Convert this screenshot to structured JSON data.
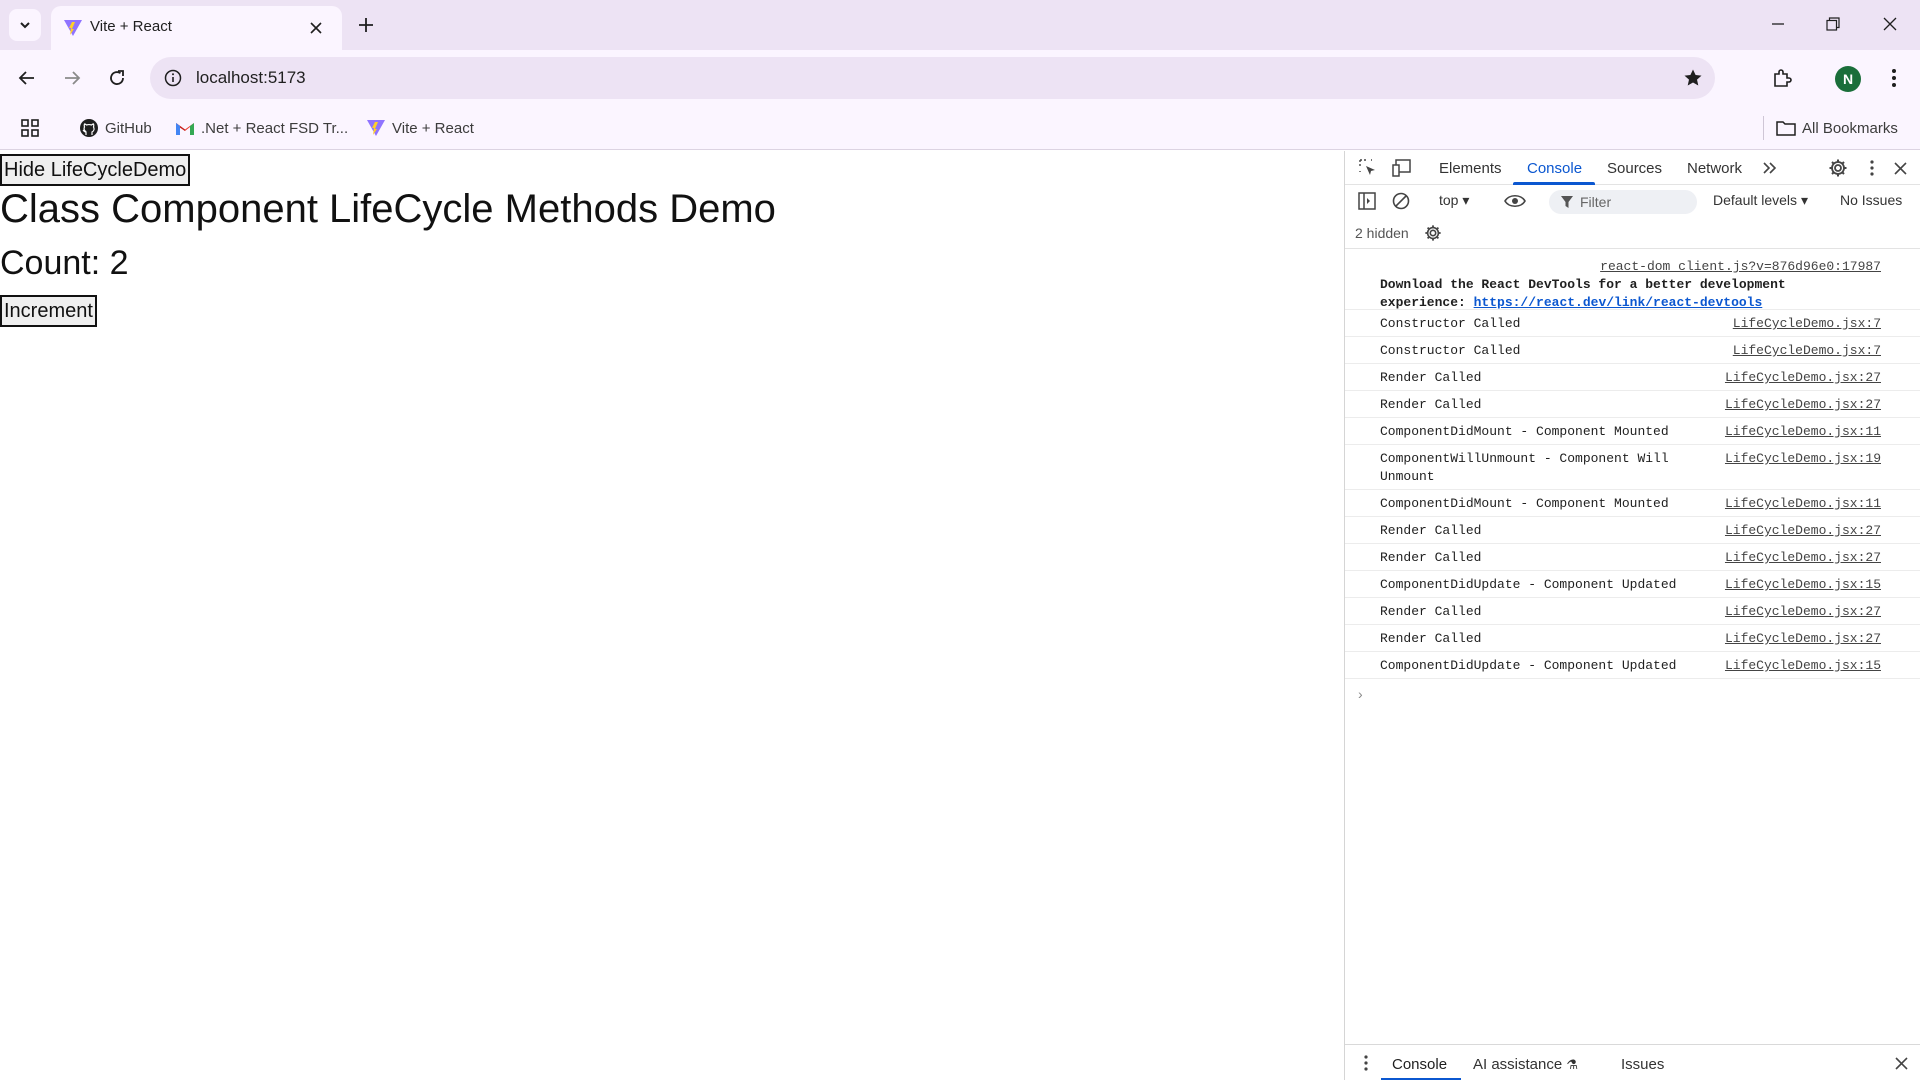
{
  "browser": {
    "tab_title": "Vite + React",
    "url": "localhost:5173",
    "profile_initial": "N",
    "bookmarks": [
      {
        "label": "GitHub",
        "icon": "github-icon"
      },
      {
        "label": ".Net + React FSD Tr...",
        "icon": "gmail-icon"
      },
      {
        "label": "Vite + React",
        "icon": "vite-icon"
      }
    ],
    "all_bookmarks_label": "All Bookmarks"
  },
  "page": {
    "hide_button_label": "Hide LifeCycleDemo",
    "heading": "Class Component LifeCycle Methods Demo",
    "count_text": "Count: 2",
    "increment_button_label": "Increment"
  },
  "devtools": {
    "tabs": [
      "Elements",
      "Console",
      "Sources",
      "Network"
    ],
    "active_tab": "Console",
    "context": "top",
    "filter_placeholder": "Filter",
    "levels": "Default levels",
    "issues": "No Issues",
    "hidden": "2 hidden",
    "console_messages": [
      {
        "source": "react-dom_client.js?v=876d96e0:17987",
        "text_bold": "Download the React DevTools for a better development experience: ",
        "link": "https://react.dev/link/react-devtools"
      },
      {
        "text": "Constructor Called",
        "source": "LifeCycleDemo.jsx:7"
      },
      {
        "text": "Constructor Called",
        "source": "LifeCycleDemo.jsx:7"
      },
      {
        "text": "Render Called",
        "source": "LifeCycleDemo.jsx:27"
      },
      {
        "text": "Render Called",
        "source": "LifeCycleDemo.jsx:27"
      },
      {
        "text": "ComponentDidMount - Component Mounted",
        "source": "LifeCycleDemo.jsx:11"
      },
      {
        "text": "ComponentWillUnmount - Component Will Unmount",
        "source": "LifeCycleDemo.jsx:19"
      },
      {
        "text": "ComponentDidMount - Component Mounted",
        "source": "LifeCycleDemo.jsx:11"
      },
      {
        "text": "Render Called",
        "source": "LifeCycleDemo.jsx:27"
      },
      {
        "text": "Render Called",
        "source": "LifeCycleDemo.jsx:27"
      },
      {
        "text": "ComponentDidUpdate - Component Updated",
        "source": "LifeCycleDemo.jsx:15"
      },
      {
        "text": "Render Called",
        "source": "LifeCycleDemo.jsx:27"
      },
      {
        "text": "Render Called",
        "source": "LifeCycleDemo.jsx:27"
      },
      {
        "text": "ComponentDidUpdate - Component Updated",
        "source": "LifeCycleDemo.jsx:15"
      }
    ],
    "drawer_tabs": [
      "Console",
      "AI assistance",
      "Issues"
    ]
  },
  "colors": {
    "tabstrip_bg": "#ede3f4",
    "toolbar_bg": "#fbf5ff",
    "devtools_accent": "#0b57d0",
    "avatar_bg": "#1a6e3a"
  }
}
